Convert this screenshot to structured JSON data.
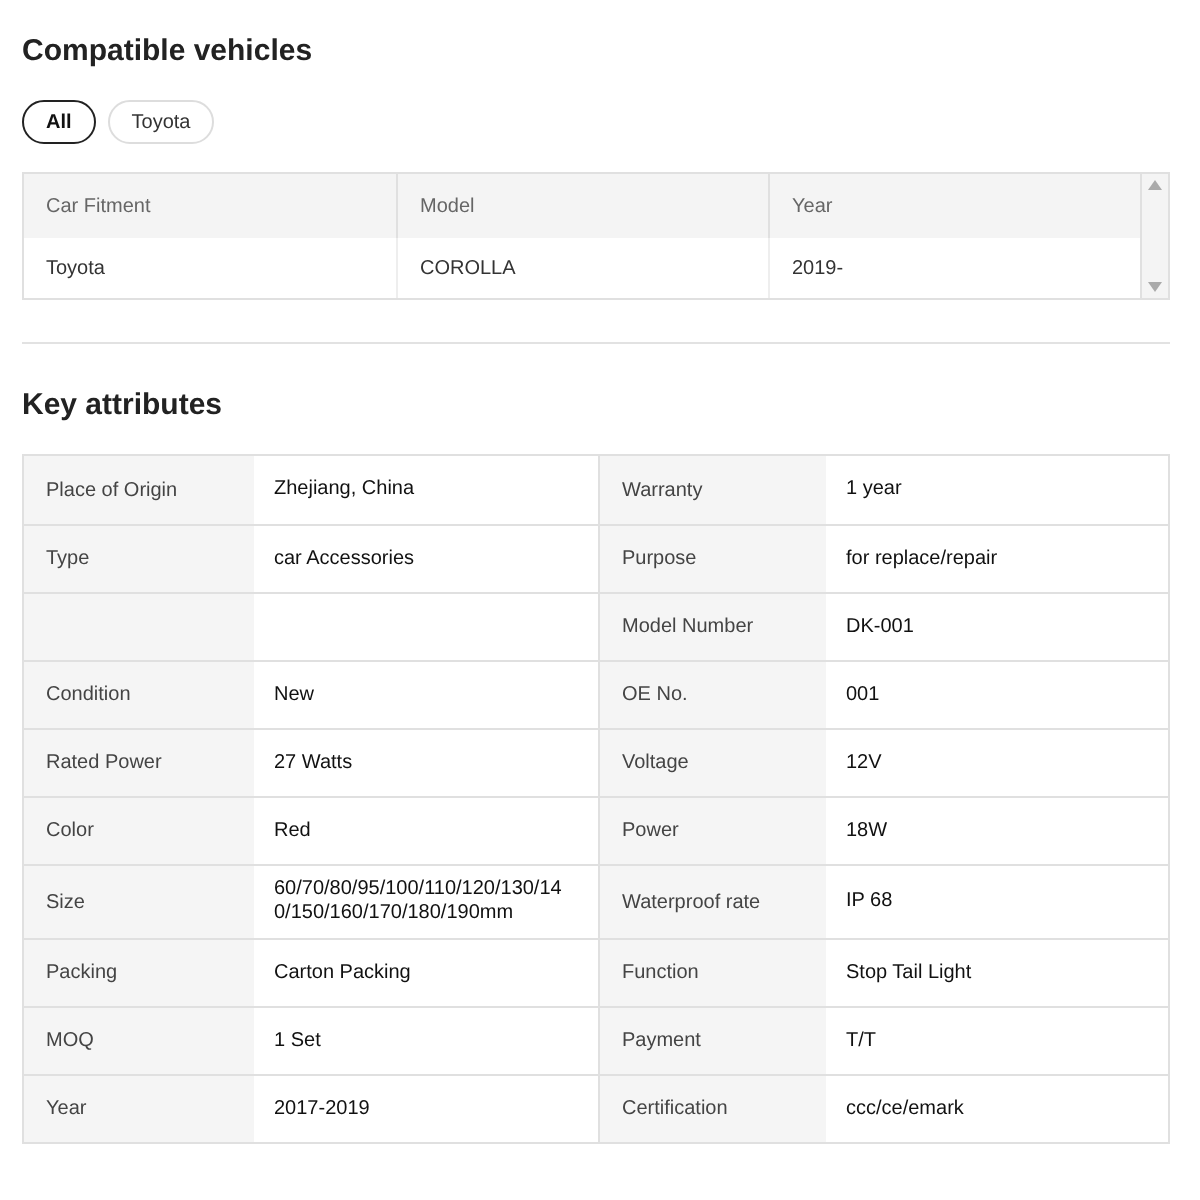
{
  "compatible_vehicles": {
    "title": "Compatible vehicles",
    "filters": [
      {
        "label": "All",
        "selected": true
      },
      {
        "label": "Toyota",
        "selected": false
      }
    ],
    "table": {
      "columns": [
        "Car Fitment",
        "Model",
        "Year"
      ],
      "rows": [
        [
          "Toyota",
          "COROLLA",
          "2019-"
        ]
      ]
    }
  },
  "key_attributes": {
    "title": "Key attributes",
    "rows": [
      {
        "cells": [
          {
            "label": "Place of Origin",
            "value": "Zhejiang, China"
          },
          {
            "label": "Warranty",
            "value": "1 year"
          }
        ]
      },
      {
        "cells": [
          {
            "label": "Type",
            "value": "car Accessories"
          },
          {
            "label": "Purpose",
            "value": "for replace/repair"
          }
        ]
      },
      {
        "cells": [
          {},
          {
            "label": "Model Number",
            "value": "DK-001"
          }
        ]
      },
      {
        "cells": [
          {
            "label": "Condition",
            "value": "New"
          },
          {
            "label": "OE No.",
            "value": "001"
          }
        ]
      },
      {
        "cells": [
          {
            "label": "Rated Power",
            "value": "27 Watts"
          },
          {
            "label": "Voltage",
            "value": "12V"
          }
        ]
      },
      {
        "cells": [
          {
            "label": "Color",
            "value": "Red"
          },
          {
            "label": "Power",
            "value": "18W"
          }
        ]
      },
      {
        "cells": [
          {
            "label": "Size",
            "value": "60/70/80/95/100/110/120/130/140/150/160/170/180/190mm"
          },
          {
            "label": "Waterproof rate",
            "value": "IP 68"
          }
        ]
      },
      {
        "cells": [
          {
            "label": "Packing",
            "value": "Carton Packing"
          },
          {
            "label": "Function",
            "value": "Stop Tail Light"
          }
        ]
      },
      {
        "cells": [
          {
            "label": "MOQ",
            "value": "1 Set"
          },
          {
            "label": "Payment",
            "value": "T/T"
          }
        ]
      },
      {
        "cells": [
          {
            "label": "Year",
            "value": "2017-2019"
          },
          {
            "label": "Certification",
            "value": "ccc/ce/emark"
          }
        ]
      }
    ]
  }
}
